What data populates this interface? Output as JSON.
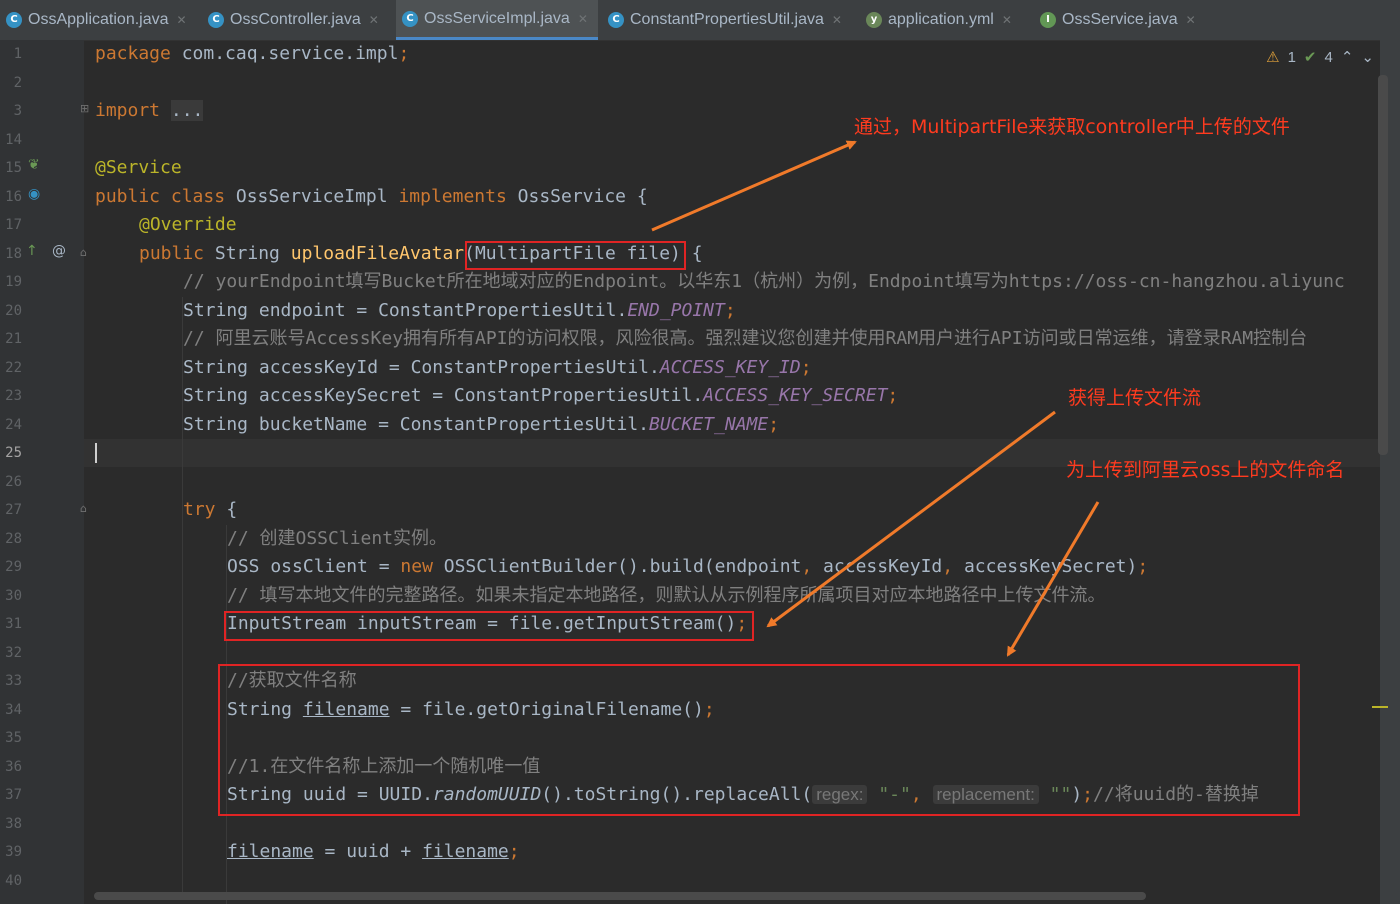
{
  "tabs": [
    {
      "label": "OssApplication.java",
      "icon": "spring-class-icon",
      "color": "#3592c4",
      "active": false
    },
    {
      "label": "OssController.java",
      "icon": "class-icon",
      "color": "#3592c4",
      "active": false
    },
    {
      "label": "OssServiceImpl.java",
      "icon": "class-icon",
      "color": "#3592c4",
      "active": true
    },
    {
      "label": "ConstantPropertiesUtil.java",
      "icon": "class-icon",
      "color": "#3592c4",
      "active": false
    },
    {
      "label": "application.yml",
      "icon": "yaml-icon",
      "color": "#6a8759",
      "active": false
    },
    {
      "label": "OssService.java",
      "icon": "interface-icon",
      "color": "#629755",
      "active": false
    }
  ],
  "inspections": {
    "warnings": "1",
    "checks": "4"
  },
  "line_numbers": [
    "1",
    "2",
    "3",
    "14",
    "15",
    "16",
    "17",
    "18",
    "19",
    "20",
    "21",
    "22",
    "23",
    "24",
    "25",
    "26",
    "27",
    "28",
    "29",
    "30",
    "31",
    "32",
    "33",
    "34",
    "35",
    "36",
    "37",
    "38",
    "39",
    "40"
  ],
  "current_line": "25",
  "code": {
    "l1_kw": "package",
    "l1_rest": " com.caq.service.impl",
    "l1_semi": ";",
    "l3_kw": "import",
    "l3_fold": "...",
    "l15": "@Service",
    "l16_kw1": "public class",
    "l16_name": " OssServiceImpl ",
    "l16_kw2": "implements",
    "l16_rest": " OssService {",
    "l17": "@Override",
    "l18_kw": "public",
    "l18_type": " String ",
    "l18_fn": "uploadFileAvatar",
    "l18_params": "(MultipartFile file)",
    "l18_end": " {",
    "l19": "// yourEndpoint填写Bucket所在地域对应的Endpoint。以华东1（杭州）为例，Endpoint填写为https://oss-cn-hangzhou.aliyunc",
    "l20_a": "String endpoint = ConstantPropertiesUtil.",
    "l20_c": "END_POINT",
    "l20_s": ";",
    "l21": "// 阿里云账号AccessKey拥有所有API的访问权限，风险很高。强烈建议您创建并使用RAM用户进行API访问或日常运维，请登录RAM控制台",
    "l22_a": "String accessKeyId = ConstantPropertiesUtil.",
    "l22_c": "ACCESS_KEY_ID",
    "l22_s": ";",
    "l23_a": "String accessKeySecret = ConstantPropertiesUtil.",
    "l23_c": "ACCESS_KEY_SECRET",
    "l23_s": ";",
    "l24_a": "String bucketName = ConstantPropertiesUtil.",
    "l24_c": "BUCKET_NAME",
    "l24_s": ";",
    "l27_kw": "try",
    "l27_rest": " {",
    "l28": "// 创建OSSClient实例。",
    "l29_a": "OSS ossClient = ",
    "l29_kw": "new",
    "l29_b": " OSSClientBuilder().build(endpoint",
    "l29_c1": ",",
    "l29_d": " accessKeyId",
    "l29_c2": ",",
    "l29_e": " accessKeySecret)",
    "l29_s": ";",
    "l30": "// 填写本地文件的完整路径。如果未指定本地路径，则默认从示例程序所属项目对应本地路径中上传文件流。",
    "l31_a": "InputStream inputStream = file.getInputStream()",
    "l31_s": ";",
    "l33": "//获取文件名称",
    "l34_a": "String ",
    "l34_var": "filename",
    "l34_b": " = file.getOriginalFilename()",
    "l34_s": ";",
    "l36": "//1.在文件名称上添加一个随机唯一值",
    "l37_a": "String uuid = UUID.",
    "l37_fn": "randomUUID",
    "l37_b": "().toString().replaceAll(",
    "l37_h1": "regex:",
    "l37_str1": "\"-\"",
    "l37_c": ",",
    "l37_h2": "replacement:",
    "l37_str2": "\"\"",
    "l37_d": ")",
    "l37_s": ";",
    "l37_cm": "//将uuid的-替换掉",
    "l39_var1": "filename",
    "l39_b": " = uuid + ",
    "l39_var2": "filename",
    "l39_s": ";"
  },
  "annotations": {
    "note1": "通过，MultipartFile来获取controller中上传的文件",
    "note2": "获得上传文件流",
    "note3": "为上传到阿里云oss上的文件命名",
    "color": "#ff3b1f",
    "box_color": "#e02424",
    "arrow_color": "#f07a2a"
  }
}
